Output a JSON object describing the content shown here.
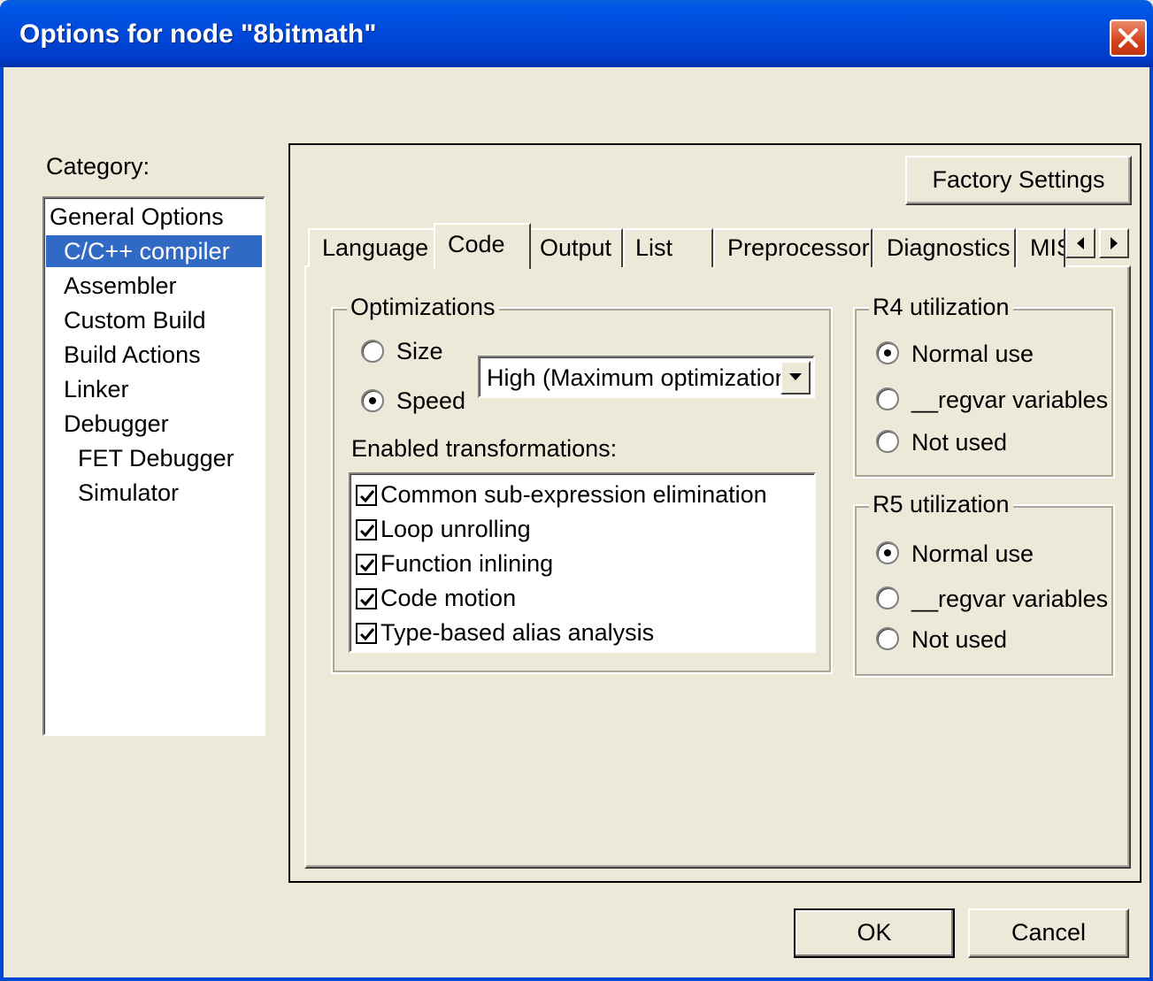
{
  "window": {
    "title": "Options for node \"8bitmath\""
  },
  "category": {
    "label": "Category:",
    "items": [
      {
        "label": "General Options",
        "selected": false
      },
      {
        "label": "C/C++ compiler",
        "selected": true
      },
      {
        "label": "Assembler",
        "selected": false
      },
      {
        "label": "Custom Build",
        "selected": false
      },
      {
        "label": "Build Actions",
        "selected": false
      },
      {
        "label": "Linker",
        "selected": false
      },
      {
        "label": "Debugger",
        "selected": false
      },
      {
        "label": "FET Debugger",
        "selected": false
      },
      {
        "label": "Simulator",
        "selected": false
      }
    ]
  },
  "panel": {
    "factory_settings_label": "Factory Settings",
    "tabs": [
      {
        "label": "Language",
        "active": false
      },
      {
        "label": "Code",
        "active": true
      },
      {
        "label": "Output",
        "active": false
      },
      {
        "label": "List",
        "active": false
      },
      {
        "label": "Preprocessor",
        "active": false
      },
      {
        "label": "Diagnostics",
        "active": false
      },
      {
        "label": "MISRA C",
        "active": false
      }
    ],
    "tab_scroll_left_icon": "arrow-left-icon",
    "tab_scroll_right_icon": "arrow-right-icon"
  },
  "optimizations": {
    "title": "Optimizations",
    "size_label": "Size",
    "speed_label": "Speed",
    "selected": "Speed",
    "level_value": "High (Maximum optimization)",
    "transformations_label": "Enabled transformations:",
    "transformations": [
      {
        "label": "Common sub-expression elimination",
        "checked": true
      },
      {
        "label": "Loop unrolling",
        "checked": true
      },
      {
        "label": "Function inlining",
        "checked": true
      },
      {
        "label": "Code motion",
        "checked": true
      },
      {
        "label": "Type-based alias analysis",
        "checked": true
      }
    ]
  },
  "r4": {
    "title": "R4 utilization",
    "options": [
      "Normal use",
      "__regvar variables",
      "Not used"
    ],
    "selected": "Normal use"
  },
  "r5": {
    "title": "R5 utilization",
    "options": [
      "Normal use",
      "__regvar variables",
      "Not used"
    ],
    "selected": "Normal use"
  },
  "buttons": {
    "ok_label": "OK",
    "cancel_label": "Cancel"
  }
}
